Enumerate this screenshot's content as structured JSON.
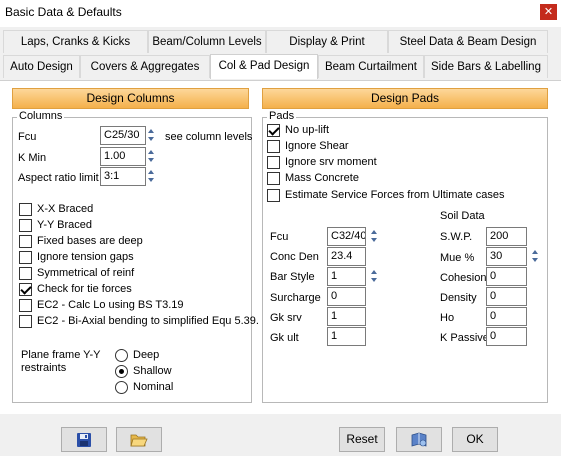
{
  "window": {
    "title": "Basic Data & Defaults",
    "close": "✕"
  },
  "tabs": {
    "row1": [
      "Laps, Cranks & Kicks",
      "Beam/Column Levels",
      "Display & Print",
      "Steel Data & Beam Design"
    ],
    "row2": [
      "Auto Design",
      "Covers & Aggregates",
      "Col & Pad Design",
      "Beam Curtailment",
      "Side Bars & Labelling"
    ],
    "active": "Col & Pad Design"
  },
  "columns": {
    "header": "Design Columns",
    "group_title": "Columns",
    "fcu_label": "Fcu",
    "fcu_value": "C25/30",
    "see_levels": "see column levels",
    "kmin_label": "K Min",
    "kmin_value": "1.00",
    "aspect_label": "Aspect ratio limit",
    "aspect_value": "3:1",
    "checks": [
      {
        "label": "X-X Braced",
        "checked": false
      },
      {
        "label": "Y-Y Braced",
        "checked": false
      },
      {
        "label": "Fixed bases are deep",
        "checked": false
      },
      {
        "label": "Ignore tension gaps",
        "checked": false
      },
      {
        "label": "Symmetrical of reinf",
        "checked": false
      },
      {
        "label": "Check for tie forces",
        "checked": true
      },
      {
        "label": "EC2 - Calc Lo using BS T3.19",
        "checked": false
      },
      {
        "label": "EC2 - Bi-Axial bending to simplified Equ 5.39.",
        "checked": false
      }
    ],
    "plane_frame_label": "Plane frame  Y-Y",
    "restraints_label": "restraints",
    "radios": [
      {
        "label": "Deep",
        "checked": false
      },
      {
        "label": "Shallow",
        "checked": true
      },
      {
        "label": "Nominal",
        "checked": false
      }
    ]
  },
  "pads": {
    "header": "Design Pads",
    "group_title": "Pads",
    "checks": [
      {
        "label": "No up-lift",
        "checked": true
      },
      {
        "label": "Ignore Shear",
        "checked": false
      },
      {
        "label": "Ignore srv moment",
        "checked": false
      },
      {
        "label": "Mass Concrete",
        "checked": false
      },
      {
        "label": "Estimate Service Forces from Ultimate cases",
        "checked": false
      }
    ],
    "fcu_label": "Fcu",
    "fcu_value": "C32/40",
    "conc_den_label": "Conc Den",
    "conc_den_value": "23.4",
    "bar_style_label": "Bar Style",
    "bar_style_value": "1",
    "surcharge_label": "Surcharge",
    "surcharge_value": "0",
    "gk_srv_label": "Gk srv",
    "gk_srv_value": "1",
    "gk_ult_label": "Gk ult",
    "gk_ult_value": "1",
    "soil_data_label": "Soil Data",
    "swp_label": "S.W.P.",
    "swp_value": "200",
    "mue_label": "Mue %",
    "mue_value": "30",
    "cohesion_label": "Cohesion",
    "cohesion_value": "0",
    "density_label": "Density",
    "density_value": "0",
    "ho_label": "Ho",
    "ho_value": "0",
    "kpassive_label": "K Passive",
    "kpassive_value": "0"
  },
  "buttons": {
    "reset": "Reset",
    "ok": "OK"
  },
  "colors": {
    "header_top": "#fdd79a",
    "header_bottom": "#f4b04b",
    "close_bg": "#c42b1c"
  }
}
